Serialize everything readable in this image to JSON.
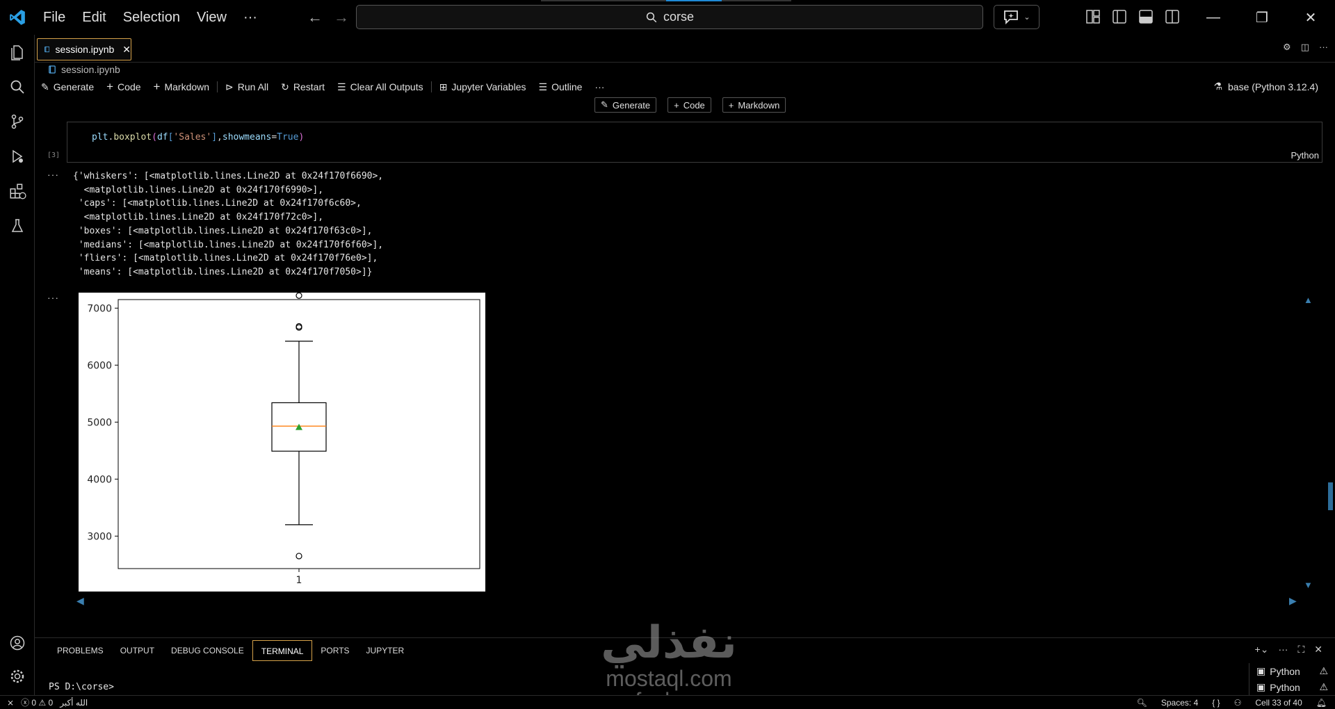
{
  "menu": [
    "File",
    "Edit",
    "Selection",
    "View",
    "···"
  ],
  "search": {
    "text": "corse"
  },
  "editor": {
    "tab_label": "session.ipynb",
    "breadcrumb": "session.ipynb"
  },
  "notebook_toolbar": {
    "generate": "Generate",
    "code": "Code",
    "markdown": "Markdown",
    "run_all": "Run All",
    "restart": "Restart",
    "clear_all_outputs": "Clear All Outputs",
    "jupyter_variables": "Jupyter Variables",
    "outline": "Outline",
    "more": "···",
    "kernel": "base (Python 3.12.4)"
  },
  "insert_strip": {
    "generate": "Generate",
    "code": "Code",
    "markdown": "Markdown"
  },
  "cell": {
    "execution_count": "[3]",
    "language": "Python",
    "output_lines": [
      "{'whiskers': [<matplotlib.lines.Line2D at 0x24f170f6690>,",
      "  <matplotlib.lines.Line2D at 0x24f170f6990>],",
      " 'caps': [<matplotlib.lines.Line2D at 0x24f170f6c60>,",
      "  <matplotlib.lines.Line2D at 0x24f170f72c0>],",
      " 'boxes': [<matplotlib.lines.Line2D at 0x24f170f63c0>],",
      " 'medians': [<matplotlib.lines.Line2D at 0x24f170f6f60>],",
      " 'fliers': [<matplotlib.lines.Line2D at 0x24f170f76e0>],",
      " 'means': [<matplotlib.lines.Line2D at 0x24f170f7050>]}"
    ],
    "output_more": "···"
  },
  "chart_data": {
    "type": "boxplot",
    "categories": [
      "1"
    ],
    "ylim": [
      2430,
      7150
    ],
    "yticks": [
      3000,
      4000,
      5000,
      6000,
      7000
    ],
    "box": {
      "whisker_low": 3200,
      "q1": 4490,
      "median": 4930,
      "q3": 5340,
      "whisker_high": 6420,
      "mean": 4910,
      "fliers": [
        7220,
        6680,
        6660,
        2650
      ]
    },
    "colors": {
      "median": "#ff7f0e",
      "mean": "#2ca02c",
      "box": "#000000"
    },
    "showmeans": true
  },
  "panel": {
    "tabs": [
      "PROBLEMS",
      "OUTPUT",
      "DEBUG CONSOLE",
      "TERMINAL",
      "PORTS",
      "JUPYTER"
    ],
    "active_tab": "TERMINAL",
    "prompt": "PS D:\\corse>",
    "terminals": [
      "Python",
      "Python"
    ]
  },
  "status": {
    "errors": "0",
    "warnings": "0",
    "extra": "الله أكبر",
    "spaces": "Spaces: 4",
    "braces": "{ }",
    "cell": "Cell 33 of 40"
  },
  "watermark": {
    "arabic": "نفذلي",
    "url_1": "mostaql.com",
    "url_2": "nafezly.com"
  }
}
